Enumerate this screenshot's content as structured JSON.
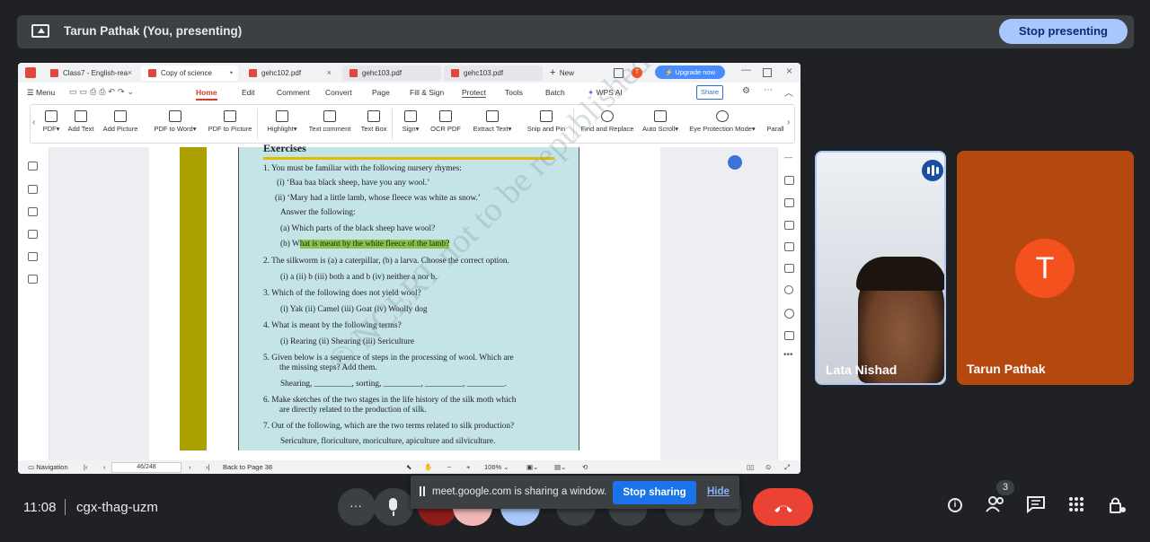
{
  "presenting_bar": {
    "title": "Tarun Pathak (You, presenting)",
    "stop_label": "Stop presenting"
  },
  "window": {
    "tabs": [
      {
        "label": "Class7 - English-rea"
      },
      {
        "label": "Copy of science"
      },
      {
        "label": "gehc102.pdf"
      },
      {
        "label": "gehc103.pdf"
      },
      {
        "label": "gehc103.pdf"
      }
    ],
    "new_tab_label": "New",
    "upgrade_label": "Upgrade now",
    "menu": [
      "Menu",
      "Home",
      "Edit",
      "Comment",
      "Convert",
      "Page",
      "Fill & Sign",
      "Protect",
      "Tools",
      "Batch",
      "WPS AI"
    ],
    "share_label": "Share",
    "ribbon": [
      "PDF",
      "Add Text",
      "Add Picture",
      "PDF to Word",
      "PDF to Picture",
      "Highlight",
      "Text comment",
      "Text Box",
      "Sign",
      "OCR PDF",
      "Extract Text",
      "Snip and Pin",
      "Find and Replace",
      "Auto Scroll",
      "Eye Protection Mode",
      "Parall"
    ],
    "doc": {
      "heading": "Exercises",
      "lines": [
        "1.   You must be familiar with the following nursery rhymes:",
        "(i)   ‘Baa baa black sheep, have you any wool.’",
        "(ii)   ‘Mary had a little lamb, whose fleece was white as snow.’",
        "Answer the following:",
        "(a)   Which parts of the black sheep have wool?",
        "2.   The silkworm is (a) a caterpillar, (b) a larva. Choose the correct option.",
        "(i)   a      (ii)  b       (iii)  both a and b       (iv)   neither a nor b.",
        "3.   Which of the following does not yield wool?",
        "(i)   Yak      (ii)  Camel      (iii)  Goat    (iv)  Woolly dog",
        "4.   What is meant by the following terms?",
        "(i)  Rearing (ii) Shearing   (iii) Sericulture",
        "5.   Given below is a sequence of steps in the processing of wool. Which are",
        "the missing steps? Add them.",
        "Shearing, _________, sorting, _________, _________, _________.",
        "6.   Make sketches of the two stages in the life history of the silk moth which",
        "are directly related to the production of silk.",
        "7.   Out of the following, which are the two terms related to silk production?",
        "Sericulture, floriculture, moriculture, apiculture and silviculture."
      ],
      "q_b_prefix": "(b)   W",
      "q_b_highlight": "hat is meant by the white fleece of the lamb?",
      "watermark": "© NCERT not to be republished"
    },
    "status": {
      "navigation": "Navigation",
      "page": "46/248",
      "back_to": "Back to Page 38",
      "zoom": "106%"
    }
  },
  "participants": [
    {
      "name": "Lata Nishad"
    },
    {
      "name": "Tarun Pathak",
      "initial": "T"
    }
  ],
  "bottom": {
    "time": "11:08",
    "meeting_code": "cgx-thag-uzm",
    "people_count": "3"
  },
  "share_banner": {
    "text": "meet.google.com is sharing a window.",
    "stop_label": "Stop sharing",
    "hide_label": "Hide"
  },
  "colors": {
    "accent": "#a8c7fa",
    "end_call": "#ea4335",
    "stop_sharing": "#1a73e8",
    "avatar": "#f4511e"
  }
}
